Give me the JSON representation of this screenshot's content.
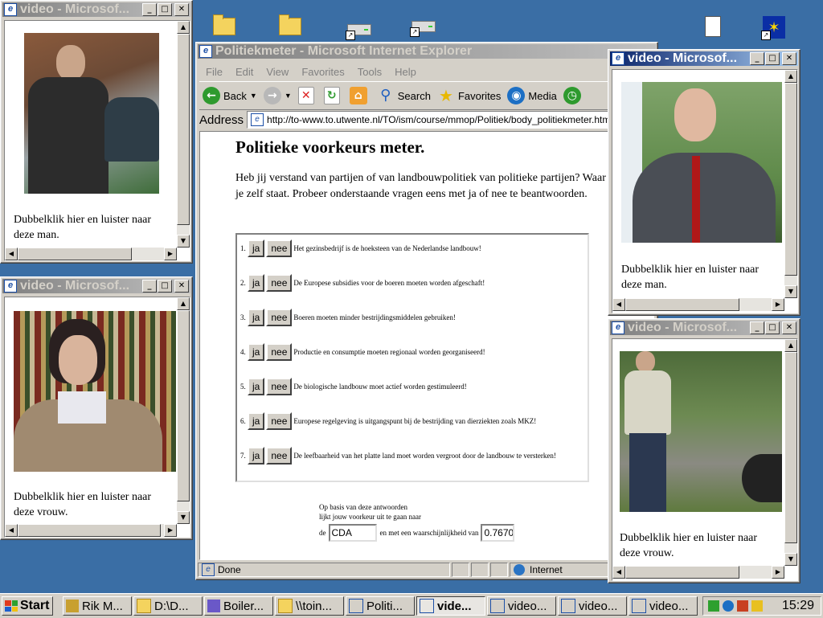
{
  "desktop": {
    "icons": [
      "folder-icon",
      "folder-icon",
      "drive-shortcut-icon",
      "drive-shortcut-icon",
      "document-icon",
      "eu-flag-icon"
    ]
  },
  "video_windows": [
    {
      "title": "video - Microsof...",
      "caption": "Dubbelklik hier en luister naar deze man."
    },
    {
      "title": "video - Microsof...",
      "caption": "Dubbelklik hier en luister naar deze vrouw."
    },
    {
      "title": "video - Microsof...",
      "caption": "Dubbelklik hier en luister naar deze man."
    },
    {
      "title": "video - Microsof...",
      "caption": "Dubbelklik hier en luister naar deze vrouw."
    }
  ],
  "ie": {
    "title": "Politiekmeter - Microsoft Internet Explorer",
    "menu": [
      "File",
      "Edit",
      "View",
      "Favorites",
      "Tools",
      "Help"
    ],
    "toolbar": {
      "back": "Back",
      "search": "Search",
      "favorites": "Favorites",
      "media": "Media"
    },
    "address_label": "Address",
    "url": "http://to-www.to.utwente.nl/TO/ism/course/mmop/Politiek/body_politiekmeter.html",
    "status": "Done",
    "zone": "Internet"
  },
  "page": {
    "heading": "Politieke voorkeurs meter.",
    "intro": "Heb jij verstand van partijen of van landbouwpolitiek van politieke partijen? Waar denk je waar je zelf staat. Probeer onderstaande vragen eens met ja of nee te beantwoorden.",
    "yes_label": "ja",
    "no_label": "nee",
    "questions": [
      "Het gezinsbedrijf is de hoeksteen van de Nederlandse landbouw!",
      "De Europese subsidies voor de boeren moeten worden afgeschaft!",
      "Boeren moeten minder bestrijdingsmiddelen gebruiken!",
      "Productie en consumptie moeten regionaal worden georganiseerd!",
      "De biologische landbouw moet actief worden gestimuleerd!",
      "Europese regelgeving is uitgangspunt bij de bestrijding van dierziekten zoals MKZ!",
      "De leefbaarheid van het platte land moet worden vergroot door de landbouw te versterken!"
    ],
    "result_line1": "Op basis van deze antwoorden",
    "result_line2": "lijkt jouw voorkeur uit te gaan naar",
    "result_prefix": "de",
    "result_mid": "en met een waarschijnlijkheid van",
    "party": "CDA",
    "probability": "0.7670"
  },
  "taskbar": {
    "start": "Start",
    "tasks": [
      "Rik M...",
      "D:\\D...",
      "Boiler...",
      "\\\\toin...",
      "Politi...",
      "vide...",
      "video...",
      "video...",
      "video..."
    ],
    "clock": "15:29"
  }
}
